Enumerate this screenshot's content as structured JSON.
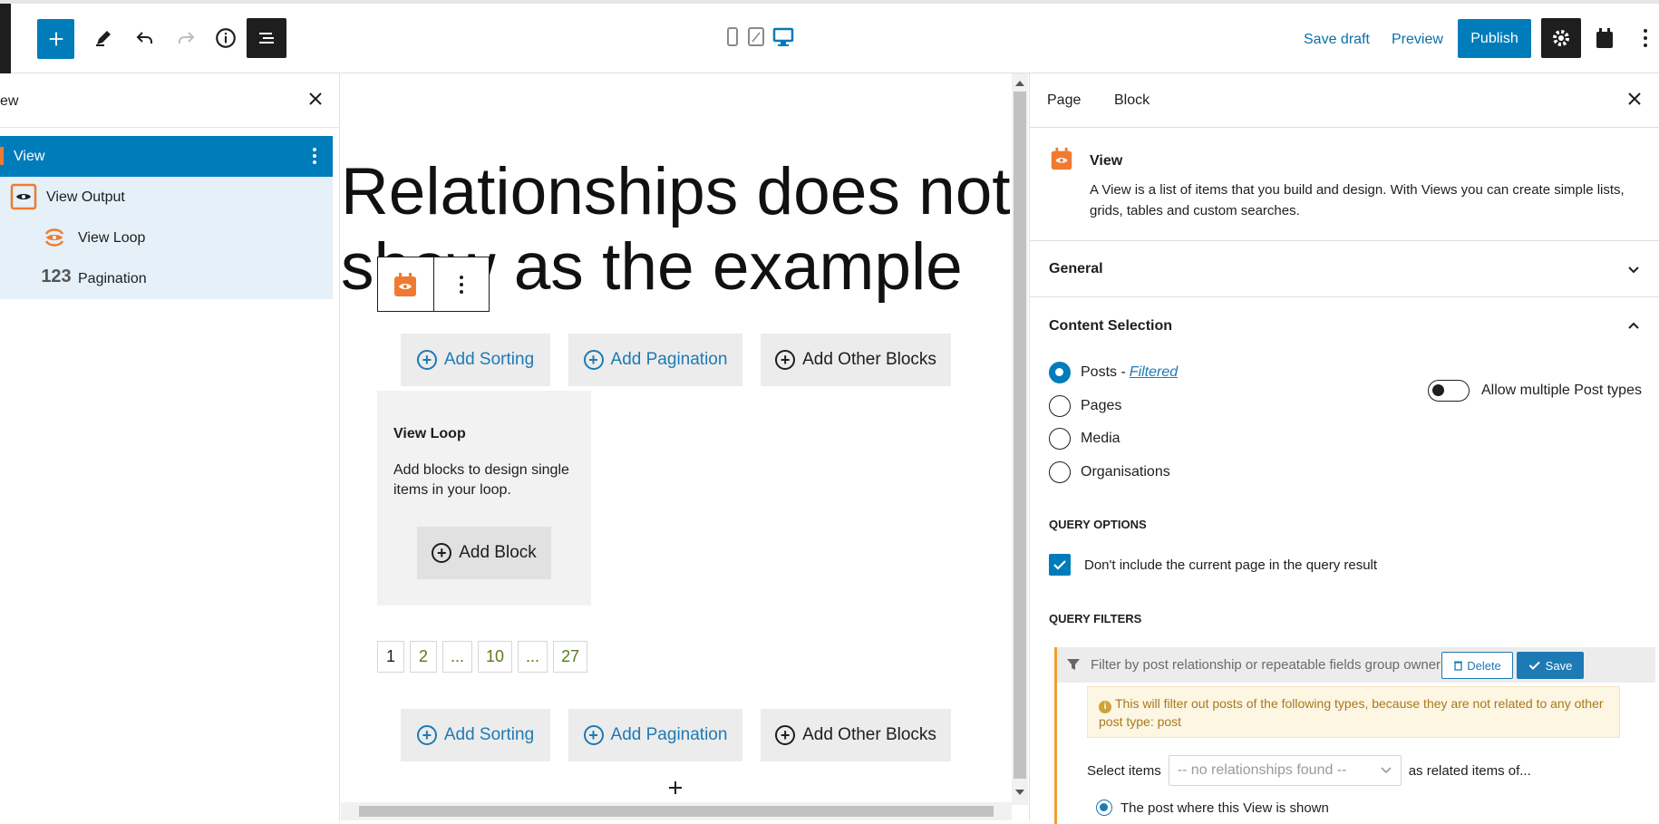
{
  "toolbar": {
    "save_draft": "Save draft",
    "preview": "Preview",
    "publish": "Publish"
  },
  "list_view": {
    "title": "ew",
    "items": [
      {
        "label": "View",
        "icon": "view-block-icon",
        "selected": true
      },
      {
        "label": "View Output",
        "icon": "eye-icon"
      },
      {
        "label": "View Loop",
        "icon": "loop-eye-icon"
      },
      {
        "label": "Pagination",
        "icon": "pagination-123-icon",
        "icon_text": "123"
      }
    ]
  },
  "canvas": {
    "title_line1": "Relationships does not",
    "title_line2": "show as the example",
    "add_sorting": "Add Sorting",
    "add_pagination": "Add Pagination",
    "add_other_blocks": "Add Other Blocks",
    "loop_title": "View Loop",
    "loop_text": "Add blocks to design single items in your loop.",
    "add_block": "Add Block",
    "pagination": [
      "1",
      "2",
      "...",
      "10",
      "...",
      "27"
    ]
  },
  "sidebar": {
    "tabs": [
      "Page",
      "Block"
    ],
    "active_tab": "Block",
    "block_name": "View",
    "block_description": "A View is a list of items that you build and design. With Views you can create simple lists, grids, tables and custom searches.",
    "panel_general": "General",
    "panel_content_selection": "Content Selection",
    "post_types": [
      {
        "label": "Posts -",
        "checked": true,
        "link": "Filtered"
      },
      {
        "label": "Pages",
        "checked": false
      },
      {
        "label": "Media",
        "checked": false
      },
      {
        "label": "Organisations",
        "checked": false
      }
    ],
    "allow_multiple": "Allow multiple Post types",
    "query_options_caption": "QUERY OPTIONS",
    "exclude_current": "Don't include the current page in the query result",
    "query_filters_caption": "QUERY FILTERS",
    "filter_title": "Filter by post relationship or repeatable fields group owner",
    "delete": "Delete",
    "save": "Save",
    "notice": "This will filter out posts of the following types, because they are not related to any other post type: post",
    "select_items_label": "Select items",
    "select_value": "-- no relationships found --",
    "related_items_of": "as related items of...",
    "post_where_shown": "The post where this View is shown"
  },
  "colors": {
    "accent": "#007cba",
    "brand_orange": "#f07a30",
    "link_blue": "#1d7ab5",
    "warning_border": "#f0a030"
  }
}
